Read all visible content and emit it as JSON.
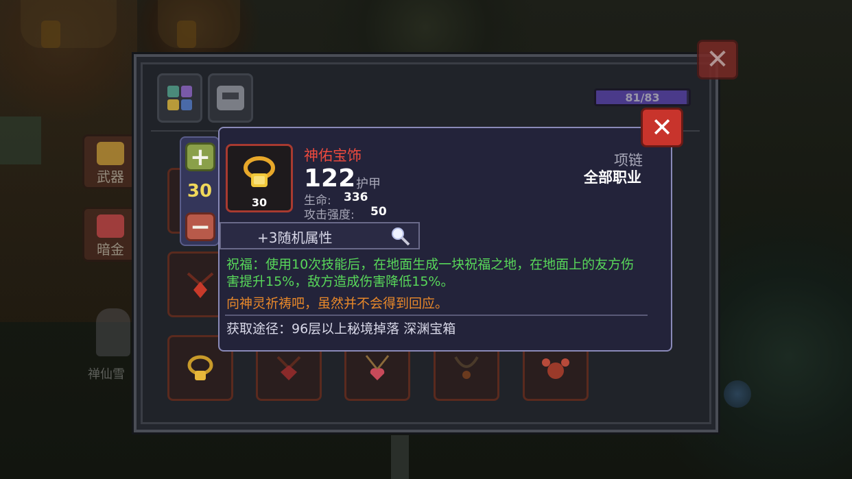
{
  "background": {
    "npc_label": "禅仙雪"
  },
  "panel": {
    "progress_text": "81/83",
    "progress_fraction": 0.976,
    "side_categories": [
      {
        "label": "武器",
        "icon": "weapon-tag-icon"
      },
      {
        "label": "暗金",
        "icon": "dark-gold-bag-icon"
      }
    ],
    "grid_items": [
      {
        "icon": "amulet-red-icon"
      },
      {
        "icon": "golden-ring-icon"
      },
      {
        "icon": "ruby-necklace-icon"
      },
      {
        "icon": "heart-necklace-icon"
      },
      {
        "icon": "bead-necklace-icon"
      },
      {
        "icon": "crab-amulet-icon"
      }
    ]
  },
  "quantity": {
    "plus_symbol": "+",
    "minus_symbol": "−",
    "value": "30"
  },
  "tooltip": {
    "item_name": "神佑宝饰",
    "item_level": "30",
    "main_value": "122",
    "main_label": "护甲",
    "stats": [
      {
        "label": "生命:",
        "value": "336"
      },
      {
        "label": "攻击强度:",
        "value": "50"
      }
    ],
    "slot_type": "项链",
    "class_restriction": "全部职业",
    "random_attributes": "+3随机属性",
    "blessing_text": "祝福：使用10次技能后，在地面生成一块祝福之地，在地面上的友方伤害提升15%，敌方造成伤害降低15%。",
    "flavor_text": "向神灵祈祷吧，虽然并不会得到回应。",
    "source_text": "获取途径：96层以上秘境掉落 深渊宝箱"
  },
  "colors": {
    "item_name": "#ee4a3e",
    "blessing": "#58d85a",
    "flavor": "#e8882a",
    "close_button": "#c8342c",
    "quantity_value": "#f0d85a"
  }
}
